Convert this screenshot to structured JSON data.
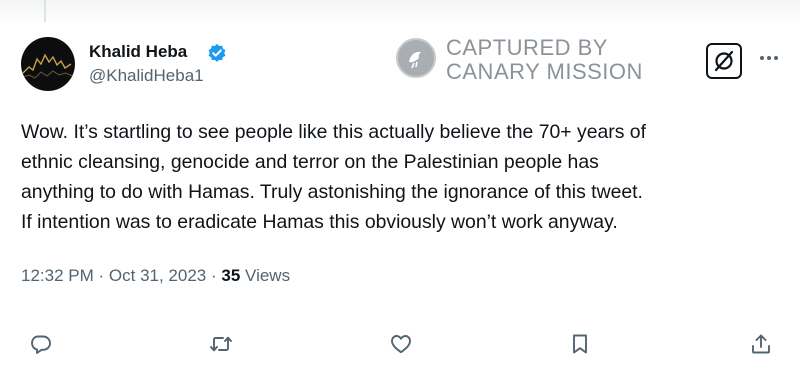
{
  "author": {
    "name": "Khalid Heba",
    "handle": "@KhalidHeba1",
    "verified": true,
    "verified_color": "#1d9bf0",
    "avatar_icon": "stock-chart-avatar"
  },
  "watermark": {
    "line1": "CAPTURED BY",
    "line2": "CANARY MISSION",
    "icon": "canary-seal-icon"
  },
  "tweet": {
    "lines": [
      "Wow. It’s startling to see people like this actually believe the 70+ years of",
      "ethnic cleansing, genocide and terror on the Palestinian people has",
      "anything to do with Hamas. Truly astonishing the ignorance of this tweet.",
      "If intention was to eradicate Hamas this obviously won’t work anyway."
    ]
  },
  "meta": {
    "time": "12:32 PM",
    "separator": "·",
    "date": "Oct 31, 2023",
    "views_count": "35",
    "views_label": "Views"
  },
  "actions": [
    {
      "name": "reply",
      "icon": "reply-icon"
    },
    {
      "name": "repost",
      "icon": "repost-icon"
    },
    {
      "name": "like",
      "icon": "heart-icon"
    },
    {
      "name": "bookmark",
      "icon": "bookmark-icon"
    },
    {
      "name": "share",
      "icon": "share-icon"
    }
  ],
  "colors": {
    "text": "#0f1419",
    "secondary": "#536471",
    "watermark": "#8b9298"
  }
}
